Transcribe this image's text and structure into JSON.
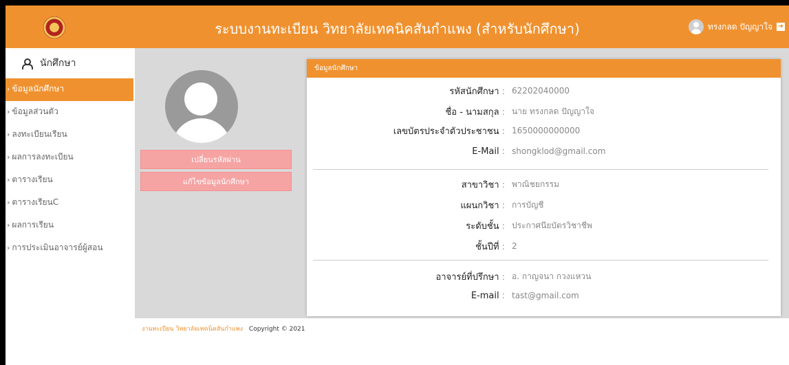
{
  "header": {
    "title": "ระบบงานทะเบียน วิทยาลัยเทคนิคสันกำแพง (สำหรับนักศึกษา)",
    "user_name": "ทรงกลด ปัญญาใจ"
  },
  "sidebar": {
    "heading": "นักศึกษา",
    "items": [
      {
        "label": "ข้อมูลนักศึกษา",
        "active": true
      },
      {
        "label": "ข้อมูลส่วนตัว"
      },
      {
        "label": "ลงทะเบียนเรียน"
      },
      {
        "label": "ผลการลงทะเบียน"
      },
      {
        "label": "ตารางเรียน"
      },
      {
        "label": "ตารางเรียนC"
      },
      {
        "label": "ผลการเรียน"
      },
      {
        "label": "การประเมินอาจารย์ผู้สอน"
      }
    ]
  },
  "profile_actions": {
    "change_password": "เปลี่ยนรหัสผ่าน",
    "edit_info": "แก้ไขข้อมูลนักศึกษา"
  },
  "card": {
    "title": "ข้อมูลนักศึกษา",
    "fields": [
      {
        "label": "รหัสนักศึกษา",
        "value": "62202040000"
      },
      {
        "label": "ชื่อ - นามสกุล",
        "value": "นาย ทรงกลด ปัญญาใจ"
      },
      {
        "label": "เลขบัตรประจำตัวประชาชน",
        "value": "1650000000000"
      },
      {
        "label": "E-Mail",
        "value": "shongklod@gmail.com"
      },
      {
        "label": "สาขาวิชา",
        "value": "พาณิชยกรรม"
      },
      {
        "label": "แผนกวิชา",
        "value": "การบัญชี"
      },
      {
        "label": "ระดับชั้น",
        "value": "ประกาศนียบัตรวิชาชีพ"
      },
      {
        "label": "ชั้นปีที่",
        "value": "2"
      },
      {
        "label": "อาจารย์ที่ปรึกษา",
        "value": "อ. กาญจนา กวงแหวน"
      },
      {
        "label": "E-mail",
        "value": "tast@gmail.com"
      }
    ],
    "colon": ":"
  },
  "footer": {
    "org": "งานทะเบียน วิทยาลัยเทคนิคสันกำแพง",
    "copyright": "Copyright © 2021"
  },
  "colors": {
    "accent": "#f0912f",
    "button_pink": "#f6a3a3",
    "content_bg": "#d9d9d9"
  }
}
